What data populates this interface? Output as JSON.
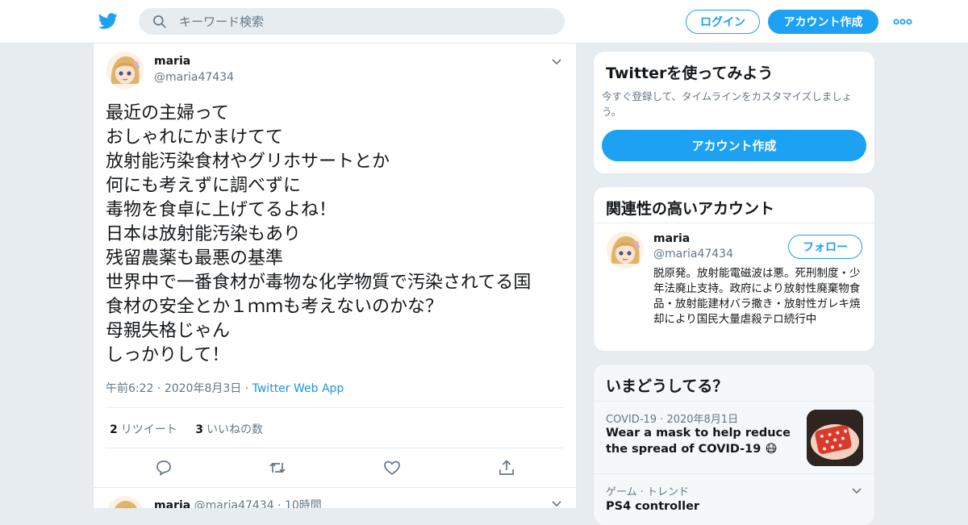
{
  "header": {
    "search_placeholder": "キーワード検索",
    "login_label": "ログイン",
    "signup_label": "アカウント作成"
  },
  "tweet": {
    "name": "maria",
    "handle": "@maria47434",
    "lines": [
      "最近の主婦って",
      "おしゃれにかまけてて",
      "放射能汚染食材やグリホサートとか",
      "何にも考えずに調べずに",
      "毒物を食卓に上げてるよね！",
      "日本は放射能汚染もあり",
      "残留農薬も最悪の基準",
      "世界中で一番食材が毒物な化学物質で汚染されてる国",
      "食材の安全とか１ｍｍも考えないのかな？",
      "母親失格じゃん",
      "しっかりして！"
    ],
    "time": "午前6:22",
    "date": "2020年8月3日",
    "via": "Twitter Web App",
    "retweet_count": "2",
    "retweet_label": "リツイート",
    "like_count": "3",
    "like_label": "いいねの数"
  },
  "next_tweet": {
    "name": "maria",
    "handle": "@maria47434",
    "time": "10時間"
  },
  "sidebar": {
    "signup": {
      "title": "Twitterを使ってみよう",
      "description": "今すぐ登録して、タイムラインをカスタマイズしましょう。",
      "button": "アカウント作成"
    },
    "related": {
      "title": "関連性の高いアカウント",
      "name": "maria",
      "handle": "@maria47434",
      "follow_label": "フォロー",
      "bio": "脱原発。放射能電磁波は悪。死刑制度・少年法廃止支持。政府により放射性廃棄物食品・放射能建材バラ撒き・放射性ガレキ焼却により国民大量虐殺テロ続行中"
    },
    "trends": {
      "title": "いまどうしてる？",
      "items": [
        {
          "meta_category": "COVID-19",
          "meta_date": "2020年8月1日",
          "title": "Wear a mask to help reduce the spread of COVID-19 😷"
        },
        {
          "meta_category": "ゲーム · トレンド",
          "title": "PS4 controller"
        }
      ]
    }
  },
  "colors": {
    "accent": "#1da1f2",
    "text": "#14171a",
    "muted": "#657786",
    "background": "#e6ecf0"
  }
}
